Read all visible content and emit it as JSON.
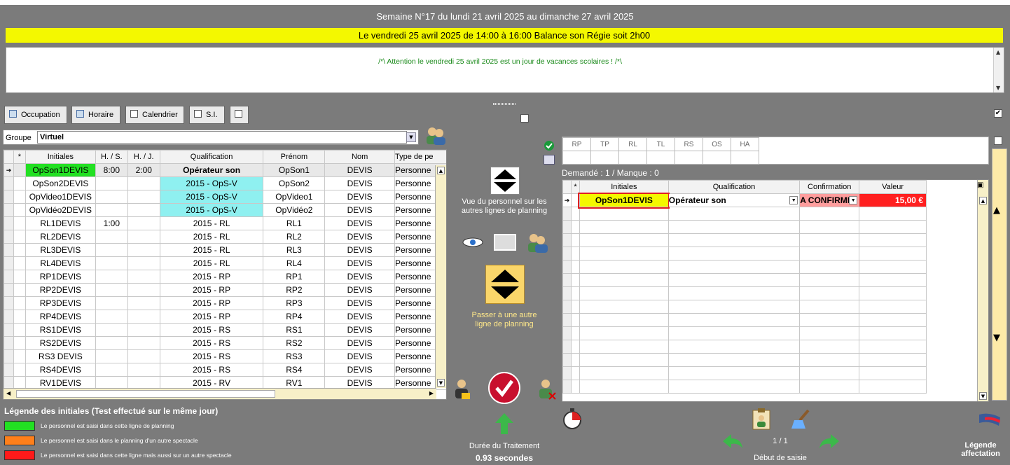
{
  "header": {
    "week": "Semaine N°17 du lundi 21 avril 2025 au dimanche 27 avril 2025",
    "event": "Le vendredi 25 avril 2025  de  14:00  à  16:00  Balance son  Régie soit 2h00",
    "note": "/*\\ Attention le vendredi 25 avril 2025 est un jour de vacances scolaires ! /*\\"
  },
  "toolbar": {
    "occupation": "Occupation",
    "horaire": "Horaire",
    "calendrier": "Calendrier",
    "si": "S.I."
  },
  "groupe": {
    "label": "Groupe",
    "value": "Virtuel"
  },
  "left_grid": {
    "headers": [
      "*",
      "Initiales",
      "H. / S.",
      "H. / J.",
      "Qualification",
      "Prénom",
      "Nom",
      "Type de pe"
    ],
    "rows": [
      {
        "ini": "OpSon1DEVIS",
        "hs": "8:00",
        "hj": "2:00",
        "qual": "Opérateur son",
        "prenom": "OpSon1",
        "nom": "DEVIS",
        "type": "Personne",
        "color": "green",
        "sel": true
      },
      {
        "ini": "OpSon2DEVIS",
        "hs": "",
        "hj": "",
        "qual": "2015 - OpS-V",
        "prenom": "OpSon2",
        "nom": "DEVIS",
        "type": "Personne",
        "cyan": true
      },
      {
        "ini": "OpVideo1DEVIS",
        "hs": "",
        "hj": "",
        "qual": "2015 - OpS-V",
        "prenom": "OpVideo1",
        "nom": "DEVIS",
        "type": "Personne",
        "cyan": true
      },
      {
        "ini": "OpVidéo2DEVIS",
        "hs": "",
        "hj": "",
        "qual": "2015 - OpS-V",
        "prenom": "OpVidéo2",
        "nom": "DEVIS",
        "type": "Personne",
        "cyan": true
      },
      {
        "ini": "RL1DEVIS",
        "hs": "1:00",
        "hj": "",
        "qual": "2015 - RL",
        "prenom": "RL1",
        "nom": "DEVIS",
        "type": "Personne"
      },
      {
        "ini": "RL2DEVIS",
        "hs": "",
        "hj": "",
        "qual": "2015 - RL",
        "prenom": "RL2",
        "nom": "DEVIS",
        "type": "Personne"
      },
      {
        "ini": "RL3DEVIS",
        "hs": "",
        "hj": "",
        "qual": "2015 - RL",
        "prenom": "RL3",
        "nom": "DEVIS",
        "type": "Personne"
      },
      {
        "ini": "RL4DEVIS",
        "hs": "",
        "hj": "",
        "qual": "2015 - RL",
        "prenom": "RL4",
        "nom": "DEVIS",
        "type": "Personne"
      },
      {
        "ini": "RP1DEVIS",
        "hs": "",
        "hj": "",
        "qual": "2015 - RP",
        "prenom": "RP1",
        "nom": "DEVIS",
        "type": "Personne"
      },
      {
        "ini": "RP2DEVIS",
        "hs": "",
        "hj": "",
        "qual": "2015 - RP",
        "prenom": "RP2",
        "nom": "DEVIS",
        "type": "Personne"
      },
      {
        "ini": "RP3DEVIS",
        "hs": "",
        "hj": "",
        "qual": "2015 - RP",
        "prenom": "RP3",
        "nom": "DEVIS",
        "type": "Personne"
      },
      {
        "ini": "RP4DEVIS",
        "hs": "",
        "hj": "",
        "qual": "2015 - RP",
        "prenom": "RP4",
        "nom": "DEVIS",
        "type": "Personne"
      },
      {
        "ini": "RS1DEVIS",
        "hs": "",
        "hj": "",
        "qual": "2015 - RS",
        "prenom": "RS1",
        "nom": "DEVIS",
        "type": "Personne"
      },
      {
        "ini": "RS2DEVIS",
        "hs": "",
        "hj": "",
        "qual": "2015 - RS",
        "prenom": "RS2",
        "nom": "DEVIS",
        "type": "Personne"
      },
      {
        "ini": "RS3 DEVIS",
        "hs": "",
        "hj": "",
        "qual": "2015 - RS",
        "prenom": "RS3",
        "nom": "DEVIS",
        "type": "Personne"
      },
      {
        "ini": "RS4DEVIS",
        "hs": "",
        "hj": "",
        "qual": "2015 - RS",
        "prenom": "RS4",
        "nom": "DEVIS",
        "type": "Personne"
      },
      {
        "ini": "RV1DEVIS",
        "hs": "",
        "hj": "",
        "qual": "2015 - RV",
        "prenom": "RV1",
        "nom": "DEVIS",
        "type": "Personne"
      }
    ]
  },
  "middle": {
    "vue_text": "Vue du personnel sur les autres lignes de planning",
    "passer_text": "Passer à une autre ligne de planning",
    "duree_label": "Durée du Traitement",
    "duree_value": "0.93 secondes"
  },
  "rp_headers": [
    "RP",
    "TP",
    "RL",
    "TL",
    "RS",
    "OS",
    "HA"
  ],
  "demande": "Demandé : 1 / Manque : 0",
  "right_grid": {
    "headers": [
      "*",
      "Initiales",
      "Qualification",
      "Confirmation",
      "Valeur"
    ],
    "row": {
      "ini": "OpSon1DEVIS",
      "qual": "Opérateur son",
      "conf": "A CONFIRME",
      "val": "15,00 €"
    }
  },
  "pager": {
    "page": "1 / 1",
    "debut": "Début de saisie"
  },
  "legend": {
    "title": "Légende des initiales (Test effectué sur le même jour)",
    "items": [
      {
        "color": "#22e022",
        "text": "Le personnel est saisi dans cette ligne de planning"
      },
      {
        "color": "#ff7f1a",
        "text": "Le personnel est saisi  dans le planning d'un autre spectacle"
      },
      {
        "color": "#ff1a1a",
        "text": "Le personnel est saisi dans cette ligne mais aussi sur un autre spectacle"
      }
    ]
  },
  "legende_affectation": "Légende affectation"
}
